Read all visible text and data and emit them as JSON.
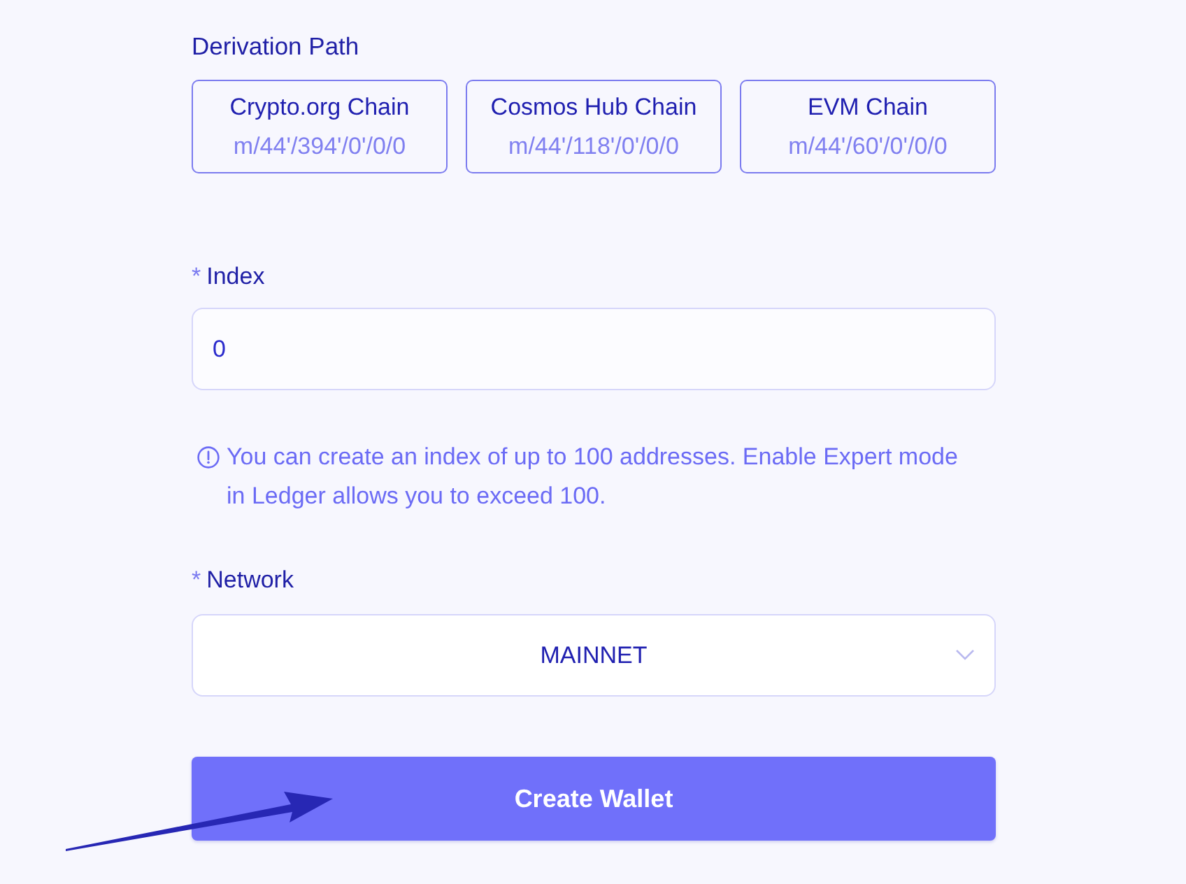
{
  "derivation_path": {
    "label": "Derivation Path",
    "options": [
      {
        "chain": "Crypto.org Chain",
        "path": "m/44'/394'/0'/0/0",
        "selected": false
      },
      {
        "chain": "Cosmos Hub Chain",
        "path": "m/44'/118'/0'/0/0",
        "selected": false
      },
      {
        "chain": "EVM Chain",
        "path": "m/44'/60'/0'/0/0",
        "selected": false
      }
    ]
  },
  "index_field": {
    "required_mark": "*",
    "label": "Index",
    "value": "0",
    "hint": "You can create an index of up to 100 addresses. Enable Expert mode in Ledger allows you to exceed 100."
  },
  "network_field": {
    "required_mark": "*",
    "label": "Network",
    "value": "MAINNET"
  },
  "create_button": {
    "label": "Create Wallet"
  }
}
